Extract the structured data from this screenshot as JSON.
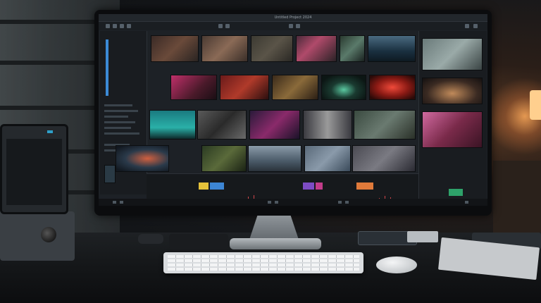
{
  "scene": "desk-with-editing-monitor",
  "monitor": {
    "window_title": "Untitled Project 2024",
    "colors": {
      "accent": "#3b8ad6",
      "panel": "#191c20",
      "screen_bg": "#1d2126",
      "swatch_yellow": "#e5c23a",
      "swatch_blue": "#3d86d4",
      "swatch_purple": "#7d4cc4",
      "swatch_magenta": "#c23c8a",
      "swatch_orange": "#e07a3a",
      "swatch_green": "#2ea26a",
      "wave_red": "#d2464b"
    }
  },
  "icons": [
    "blind-icon",
    "lamp-icon",
    "keyboard-icon",
    "mouse-icon",
    "phone-icon"
  ]
}
